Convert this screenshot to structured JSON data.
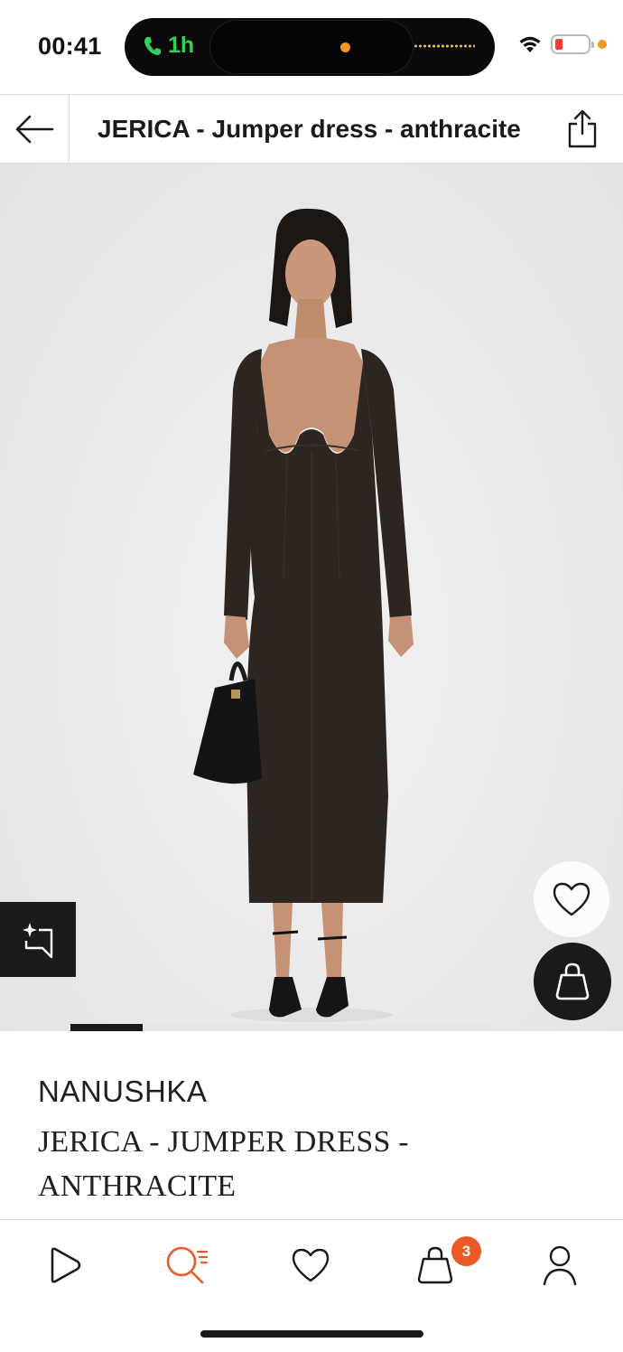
{
  "status_bar": {
    "time": "00:41",
    "call_duration": "1h",
    "icons": [
      "phone-icon",
      "wifi-icon",
      "battery-icon"
    ],
    "battery_level": 0.15
  },
  "header": {
    "title": "JERICA - Jumper dress - anthracite",
    "back_icon": "back-arrow-icon",
    "share_icon": "share-icon"
  },
  "gallery": {
    "ai_icon": "sparkle-compare-icon",
    "wishlist_icon": "heart-icon",
    "add_to_bag_icon": "bag-icon",
    "carousel_position": 0.17
  },
  "product": {
    "brand": "NANUSHKA",
    "name": "JERICA - JUMPER DRESS - ANTHRACITE"
  },
  "tabbar": {
    "items": [
      {
        "name": "home",
        "icon": "play-logo-icon"
      },
      {
        "name": "search",
        "icon": "search-icon",
        "active": true
      },
      {
        "name": "wishlist",
        "icon": "heart-icon"
      },
      {
        "name": "bag",
        "icon": "bag-icon",
        "badge": "3"
      },
      {
        "name": "profile",
        "icon": "user-icon"
      }
    ],
    "active_color": "#eb5a26"
  },
  "colors": {
    "accent": "#eb5a26",
    "text": "#1a1a1a",
    "image_background": "#ebebeb",
    "dress": "#2d2520"
  }
}
